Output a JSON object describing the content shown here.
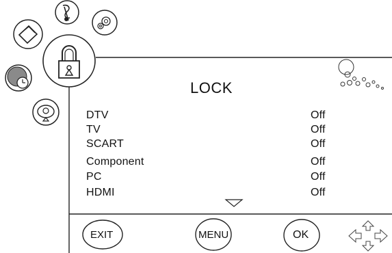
{
  "menu": {
    "title": "LOCK",
    "items": [
      {
        "label": "DTV",
        "value": "Off"
      },
      {
        "label": "TV",
        "value": "Off"
      },
      {
        "label": "SCART",
        "value": "Off"
      },
      {
        "label": "Component",
        "value": "Off"
      },
      {
        "label": "PC",
        "value": "Off"
      },
      {
        "label": "HDMI",
        "value": "Off"
      }
    ]
  },
  "side_icons": [
    "music-icon",
    "settings-icon",
    "picture-icon",
    "lock-icon",
    "clock-icon",
    "channel-icon"
  ],
  "buttons": {
    "exit_label": "EXIT",
    "menu_label": "MENU",
    "ok_label": "OK"
  }
}
